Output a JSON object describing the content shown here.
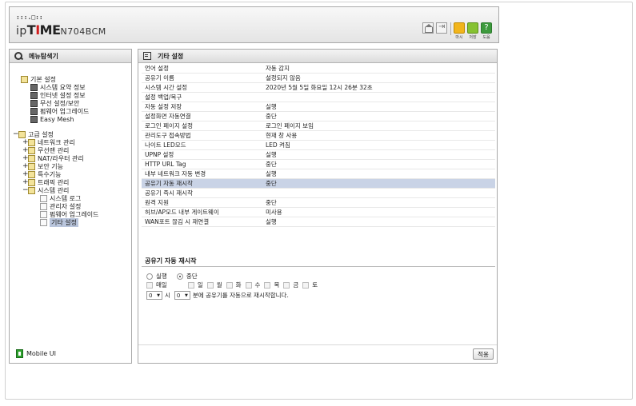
{
  "header": {
    "logo_dots": ":::.□::",
    "logo_prefix": "ip",
    "logo_time_a": "T",
    "logo_time_b": "I",
    "logo_time_c": "M",
    "logo_time_d": "E",
    "model": "N704BCM",
    "buttons": [
      {
        "name": "close",
        "label": "마시"
      },
      {
        "name": "save",
        "label": "저장"
      },
      {
        "name": "help",
        "label": "도움",
        "glyph": "?"
      }
    ]
  },
  "menu_panel": {
    "title": "메뉴탐색기",
    "nodes": [
      {
        "label": "기본 설정"
      },
      {
        "label": "시스템 요약 정보"
      },
      {
        "label": "인터넷 설정 정보"
      },
      {
        "label": "무선 설정/보안"
      },
      {
        "label": "펌웨어 업그레이드"
      },
      {
        "label": "Easy Mesh"
      },
      {
        "label": "고급 설정"
      },
      {
        "label": "네트워크 관리"
      },
      {
        "label": "무선랜 관리"
      },
      {
        "label": "NAT/라우터 관리"
      },
      {
        "label": "보안 기능"
      },
      {
        "label": "특수기능"
      },
      {
        "label": "트래픽 관리"
      },
      {
        "label": "시스템 관리"
      },
      {
        "label": "시스템 로그"
      },
      {
        "label": "관리자 설정"
      },
      {
        "label": "펌웨어 업그레이드"
      },
      {
        "label": "기타 설정"
      }
    ],
    "expanders": [
      "−",
      "+",
      "+",
      "+",
      "+",
      "+",
      "+",
      "−"
    ],
    "mobile_ui": "Mobile UI"
  },
  "settings_panel": {
    "title": "기타 설정",
    "rows": [
      {
        "key": "언어 설정",
        "value": "자동 감지"
      },
      {
        "key": "공유기 이름",
        "value": "설정되지 않음"
      },
      {
        "key": "시스템 시간 설정",
        "value": "2020년 5월 5일 화요일 12시 26분 32초"
      },
      {
        "key": "설정 백업/복구",
        "value": ""
      },
      {
        "key": "자동 설정 저장",
        "value": "실행"
      },
      {
        "key": "설정화면 자동연결",
        "value": "중단"
      },
      {
        "key": "로그인 페이지 설정",
        "value": "로그인 페이지 보임"
      },
      {
        "key": "관리도구 접속방법",
        "value": "현재 창 사용"
      },
      {
        "key": "나이트 LED모드",
        "value": "LED 켜짐"
      },
      {
        "key": "UPNP 설정",
        "value": "실행"
      },
      {
        "key": "HTTP URL Tag",
        "value": "중단"
      },
      {
        "key": "내부 네트워크 자동 변경",
        "value": "실행"
      },
      {
        "key": "공유기 자동 재시작",
        "value": "중단"
      },
      {
        "key": "공유기 즉시 재시작",
        "value": ""
      },
      {
        "key": "원격 지원",
        "value": "중단"
      },
      {
        "key": "허브/AP모드 내부 게이트웨이",
        "value": "미사용"
      },
      {
        "key": "WAN포트 끊김 시 재연결",
        "value": "실행"
      }
    ],
    "highlighted_row": "공유기 자동 재시작",
    "sub_title": "공유기 자동 재시작",
    "mode_options": [
      {
        "label": "실행",
        "selected": false
      },
      {
        "label": "중단",
        "selected": true
      }
    ],
    "every_day_label": "매일",
    "days": [
      "일",
      "월",
      "화",
      "수",
      "목",
      "금",
      "토"
    ],
    "hour_value": "0",
    "hour_unit": "시",
    "minute_value": "0",
    "minute_suffix": "분에 공유기를 자동으로 재시작합니다.",
    "apply_label": "적용"
  },
  "colors": {
    "highlight_row": "#c9d3e6",
    "tree_selected": "#b9c5dc",
    "logo_accent": "#d21c1c",
    "close_btn": "#f2b51c",
    "save_btn": "#86c232",
    "help_btn": "#3d9a3d",
    "mobile_icon": "#2ea02e"
  }
}
